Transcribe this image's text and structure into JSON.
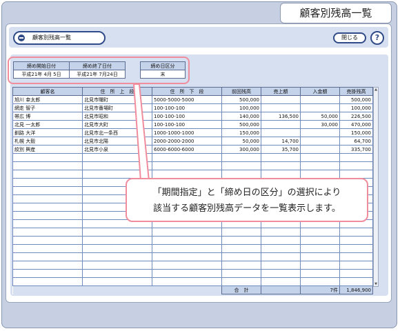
{
  "window": {
    "title": "顧客別残高一覧"
  },
  "header": {
    "page_title": "顧客別残高一覧",
    "close_label": "閉じる",
    "help_label": "?"
  },
  "filters": {
    "start": {
      "header": "締め開始日付",
      "value": "平成21年 4月 5日"
    },
    "end": {
      "header": "締め終了日付",
      "value": "平成21年 7月24日"
    },
    "closing": {
      "header": "締め日区分",
      "value": "末"
    }
  },
  "table": {
    "columns": [
      "顧客名",
      "住　所　上　段",
      "住　所　下　段",
      "前回残高",
      "売上額",
      "入金額",
      "売掛残高"
    ],
    "rows": [
      [
        "旭川 幸太郎",
        "北見市曙町",
        "5000-5000-5000",
        "500,000",
        "",
        "",
        "500,000"
      ],
      [
        "網走 智子",
        "北見市番場町",
        "100-100-100",
        "100,000",
        "",
        "",
        "100,000"
      ],
      [
        "帯広 博",
        "北見市昭和",
        "100-100-100",
        "140,000",
        "136,500",
        "50,000",
        "226,500"
      ],
      [
        "北見 一太郎",
        "北見市大町",
        "100-100-100",
        "500,000",
        "",
        "30,000",
        "470,000"
      ],
      [
        "釧路 大洋",
        "北見市北一条西",
        "1000-1000-1000",
        "150,000",
        "",
        "",
        "150,000"
      ],
      [
        "札幌 大毅",
        "北見市北陽",
        "2000-2000-2000",
        "50,000",
        "14,700",
        "",
        "64,700"
      ],
      [
        "紋別 興産",
        "北見市小泉",
        "6000-6000-6000",
        "300,000",
        "35,700",
        "",
        "335,700"
      ]
    ],
    "empty_rows": 16,
    "total": {
      "label": "合　計",
      "count": "7件",
      "amount": "1,846,900"
    }
  },
  "callout": {
    "line1": "「期間指定」と「締め日の区分」の選択により",
    "line2": "該当する顧客別残高データを一覧表示します。"
  }
}
